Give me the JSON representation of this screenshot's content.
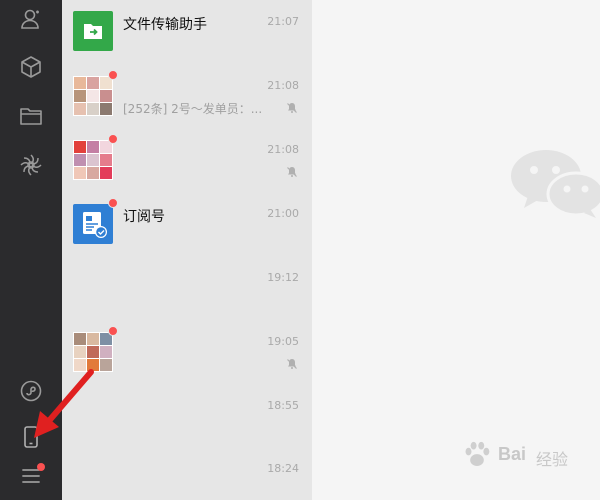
{
  "sidebar": {
    "icons": [
      "contacts-icon",
      "collections-icon",
      "files-icon",
      "moments-icon",
      "mini-programs-icon",
      "phone-icon",
      "menu-icon"
    ]
  },
  "chats": [
    {
      "name": "文件传输助手",
      "time": "21:07",
      "preview": "",
      "avatar": "file-transfer-icon",
      "unread": false,
      "muted": false
    },
    {
      "name": "",
      "time": "21:08",
      "preview": "[252条] 2号～发单员：...",
      "avatar": "group-avatar",
      "unread": true,
      "muted": true
    },
    {
      "name": "",
      "time": "21:08",
      "preview": "",
      "avatar": "group-avatar",
      "unread": true,
      "muted": true
    },
    {
      "name": "订阅号",
      "time": "21:00",
      "preview": "",
      "avatar": "subscription-icon",
      "unread": true,
      "muted": false
    },
    {
      "name": "",
      "time": "19:12",
      "preview": "",
      "avatar": "",
      "unread": false,
      "muted": false
    },
    {
      "name": "",
      "time": "19:05",
      "preview": "",
      "avatar": "group-avatar",
      "unread": true,
      "muted": true
    },
    {
      "name": "",
      "time": "18:55",
      "preview": "",
      "avatar": "",
      "unread": false,
      "muted": false
    },
    {
      "name": "",
      "time": "18:24",
      "preview": "",
      "avatar": "",
      "unread": false,
      "muted": false
    }
  ],
  "watermark": {
    "brand": "Bai",
    "suffix": "经验"
  },
  "colors": {
    "rail": "#2b2b2d",
    "list": "#e6e6e6",
    "badge": "#fa5151",
    "accent": "#1aad19",
    "arrow": "#e02020"
  }
}
